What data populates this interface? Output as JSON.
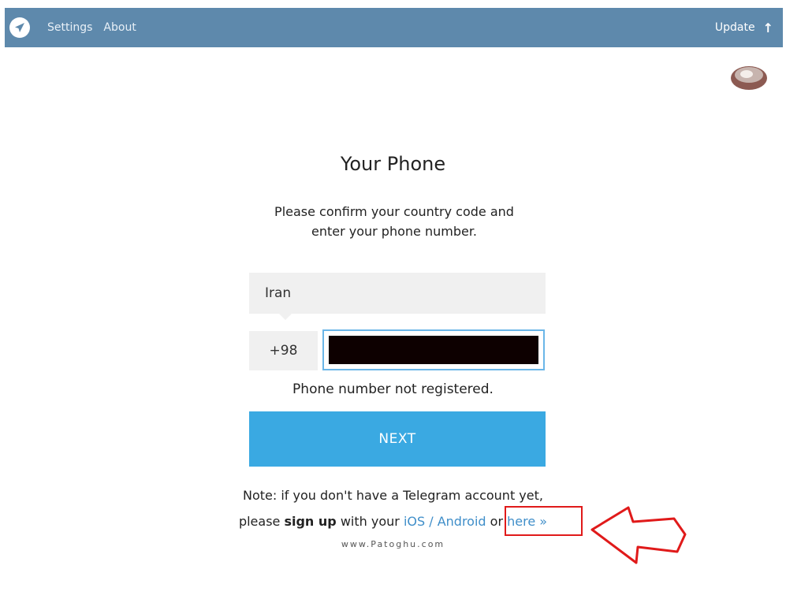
{
  "header": {
    "settings_label": "Settings",
    "about_label": "About",
    "update_label": "Update",
    "color": "#5e89ac"
  },
  "main": {
    "title": "Your Phone",
    "description_line1": "Please confirm your country code and",
    "description_line2": "enter your phone number.",
    "country": "Iran",
    "country_code": "+98",
    "phone_value": "",
    "error": "Phone number not registered.",
    "next_label": "NEXT",
    "next_color": "#3aa9e2"
  },
  "note": {
    "line1": "Note: if you don't have a Telegram account yet,",
    "please": "please",
    "sign_up": "sign up",
    "with_your": "with your",
    "ios_android": "iOS / Android",
    "or": "or",
    "here": "here »"
  },
  "watermark": "www.Patoghu.com",
  "icons": {
    "logo": "telegram-plane-icon",
    "update": "arrow-up-icon",
    "badge": "cgl-badge",
    "annotation": "red-arrow"
  }
}
